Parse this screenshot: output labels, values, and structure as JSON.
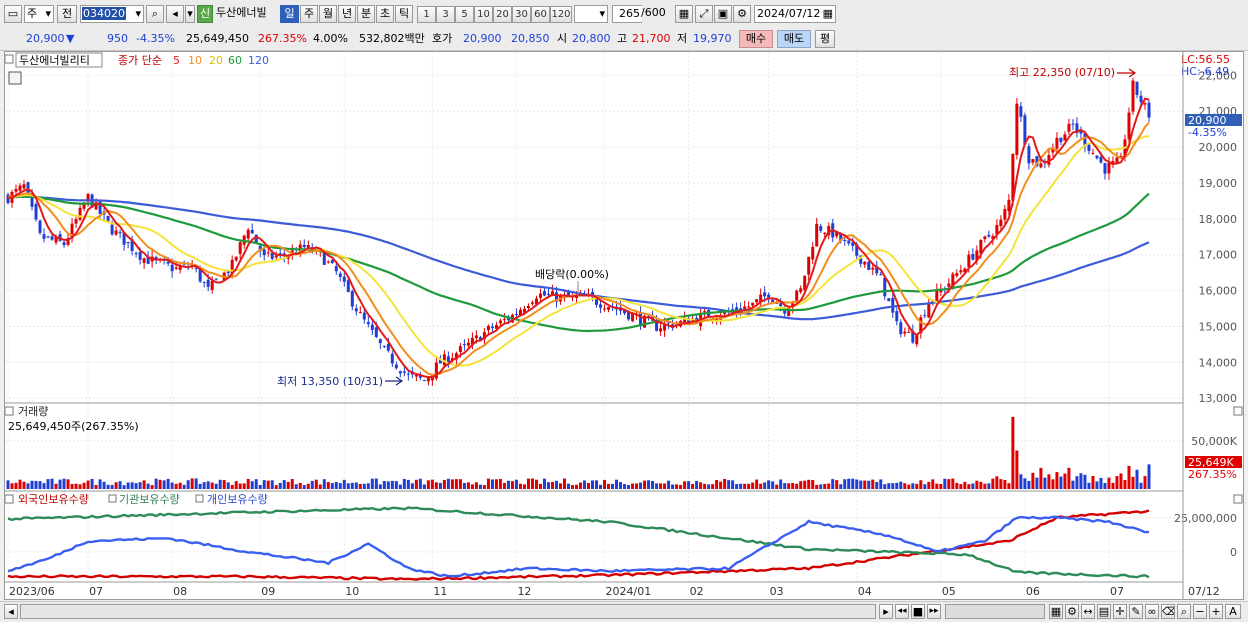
{
  "toolbar": {
    "type_select": "주",
    "all_button": "전",
    "code": "034020",
    "badge": "신",
    "name": "두산에너빌",
    "periods": [
      "일",
      "주",
      "월",
      "년",
      "분",
      "초",
      "틱"
    ],
    "minutes": [
      "1",
      "3",
      "5",
      "10",
      "20",
      "30",
      "60",
      "120"
    ],
    "count": "265",
    "total": "/600",
    "date": "2024/07/12"
  },
  "info": {
    "price": "20,900",
    "down_mark": "▼",
    "change": "950",
    "change_pct": "-4.35%",
    "volume": "25,649,450",
    "volume_ratio": "267.35%",
    "turnover": "4.00%",
    "amount": "532,802백만",
    "quote_label": "호가",
    "ask": "20,900",
    "bid": "20,850",
    "open_label": "시",
    "open": "20,800",
    "high_label": "고",
    "high": "21,700",
    "low_label": "저",
    "low": "19,970",
    "buy_button": "매수",
    "sell_button": "매도",
    "eval_button": "평"
  },
  "colors": {
    "up": "#e00000",
    "down": "#1f3fd4",
    "ma5": "#e31a1c",
    "ma10": "#f28e1c",
    "ma20": "#f5e33a",
    "ma60": "#1e9a3a",
    "ma120": "#3b5bd9",
    "foreign": "#d40000",
    "institution": "#2e8b57",
    "individual": "#3a5ff0"
  },
  "price_panel": {
    "stock_label": "두산에너빌리티",
    "ma_prefix": "종가 단순",
    "ma_periods": [
      "5",
      "10",
      "20",
      "60",
      "120"
    ],
    "lc": "LC:56.55",
    "hc": "HC:-6.49",
    "current": "20,900",
    "current_pct": "-4.35%",
    "high_annot": "최고 22,350 (07/10)",
    "low_annot": "최저 13,350 (10/31)",
    "div_annot": "배당락(0.00%)"
  },
  "volume_panel": {
    "title": "거래량",
    "value": "25,649,450주(267.35%)",
    "tag_value": "25,649K",
    "tag_pct": "267.35%"
  },
  "holdings_panel": {
    "legend": [
      "외국인보유수량",
      "기관보유수량",
      "개인보유수량"
    ]
  },
  "chart_data": {
    "type": "candlestick",
    "x_ticks": [
      "2023/06",
      "07",
      "08",
      "09",
      "10",
      "11",
      "12",
      "2024/01",
      "02",
      "03",
      "04",
      "05",
      "06",
      "07",
      "07/12"
    ],
    "price_axis": {
      "ticks": [
        "13,000",
        "14,000",
        "15,000",
        "16,000",
        "17,000",
        "18,000",
        "19,000",
        "20,000",
        "21,000",
        "22,000"
      ],
      "range": [
        12950,
        22650
      ]
    },
    "volume_axis": {
      "ticks": [
        "50,000K"
      ],
      "range": [
        0,
        78000
      ]
    },
    "holdings_axis": {
      "ticks": [
        "25,000,000",
        "0"
      ],
      "range": [
        -22000000,
        38000000
      ]
    },
    "price_anchors": [
      [
        0,
        18600
      ],
      [
        4,
        18900
      ],
      [
        8,
        17500
      ],
      [
        14,
        17300
      ],
      [
        20,
        18600
      ],
      [
        26,
        17700
      ],
      [
        34,
        16900
      ],
      [
        42,
        16600
      ],
      [
        46,
        16700
      ],
      [
        50,
        16000
      ],
      [
        56,
        16700
      ],
      [
        60,
        17800
      ],
      [
        64,
        16900
      ],
      [
        70,
        17000
      ],
      [
        74,
        17200
      ],
      [
        78,
        17000
      ],
      [
        82,
        16500
      ],
      [
        88,
        15300
      ],
      [
        94,
        14300
      ],
      [
        100,
        13600
      ],
      [
        104,
        13500
      ],
      [
        108,
        14000
      ],
      [
        114,
        14400
      ],
      [
        120,
        14900
      ],
      [
        126,
        15300
      ],
      [
        132,
        15900
      ],
      [
        138,
        15800
      ],
      [
        144,
        15800
      ],
      [
        150,
        15600
      ],
      [
        156,
        15300
      ],
      [
        162,
        15000
      ],
      [
        168,
        15100
      ],
      [
        174,
        15300
      ],
      [
        180,
        15400
      ],
      [
        186,
        15600
      ],
      [
        190,
        15900
      ],
      [
        194,
        15500
      ],
      [
        198,
        16000
      ],
      [
        202,
        17800
      ],
      [
        206,
        17600
      ],
      [
        210,
        17200
      ],
      [
        214,
        16800
      ],
      [
        218,
        16300
      ],
      [
        222,
        15000
      ],
      [
        226,
        14700
      ],
      [
        230,
        15700
      ],
      [
        234,
        16100
      ],
      [
        238,
        16600
      ],
      [
        244,
        17400
      ],
      [
        248,
        17900
      ],
      [
        250,
        18500
      ],
      [
        252,
        21300
      ],
      [
        255,
        19700
      ],
      [
        258,
        19500
      ],
      [
        262,
        20200
      ],
      [
        266,
        20600
      ],
      [
        270,
        20000
      ],
      [
        274,
        19400
      ],
      [
        278,
        19600
      ],
      [
        281,
        21700
      ],
      [
        283,
        21300
      ],
      [
        285,
        20900
      ]
    ],
    "volume_spikes": [
      [
        251,
        75000
      ],
      [
        252,
        40000
      ],
      [
        258,
        22000
      ],
      [
        265,
        22000
      ],
      [
        280,
        24000
      ],
      [
        282,
        20000
      ],
      [
        285,
        25649
      ]
    ],
    "foreign_anchors": [
      [
        0,
        -18000000
      ],
      [
        60,
        -18000000
      ],
      [
        100,
        -20000000
      ],
      [
        150,
        -17000000
      ],
      [
        200,
        -12000000
      ],
      [
        250,
        8000000
      ],
      [
        262,
        25000000
      ],
      [
        285,
        30000000
      ]
    ],
    "institution_anchors": [
      [
        0,
        24000000
      ],
      [
        60,
        29000000
      ],
      [
        100,
        32000000
      ],
      [
        150,
        22000000
      ],
      [
        200,
        2000000
      ],
      [
        240,
        -2000000
      ],
      [
        252,
        -15000000
      ],
      [
        285,
        -18000000
      ]
    ],
    "individual_anchors": [
      [
        0,
        -14000000
      ],
      [
        10,
        -5000000
      ],
      [
        20,
        8000000
      ],
      [
        40,
        10000000
      ],
      [
        60,
        0
      ],
      [
        80,
        -8000000
      ],
      [
        90,
        6000000
      ],
      [
        100,
        -12000000
      ],
      [
        110,
        -18000000
      ],
      [
        130,
        -12000000
      ],
      [
        150,
        -14000000
      ],
      [
        180,
        -12000000
      ],
      [
        200,
        22000000
      ],
      [
        220,
        12000000
      ],
      [
        232,
        0
      ],
      [
        244,
        8000000
      ],
      [
        252,
        25000000
      ],
      [
        262,
        25000000
      ],
      [
        275,
        22000000
      ],
      [
        285,
        14000000
      ]
    ]
  },
  "axis_labels": {
    "x": [
      "2023/06",
      "07",
      "08",
      "09",
      "10",
      "11",
      "12",
      "2024/01",
      "02",
      "03",
      "04",
      "05",
      "06",
      "07",
      "07/12"
    ],
    "price": [
      "22,000",
      "21,000",
      "20,000",
      "19,000",
      "18,000",
      "17,000",
      "16,000",
      "15,000",
      "14,000",
      "13,000"
    ],
    "volume": [
      "50,000K"
    ],
    "holdings": [
      "25,000,000",
      "0"
    ]
  }
}
